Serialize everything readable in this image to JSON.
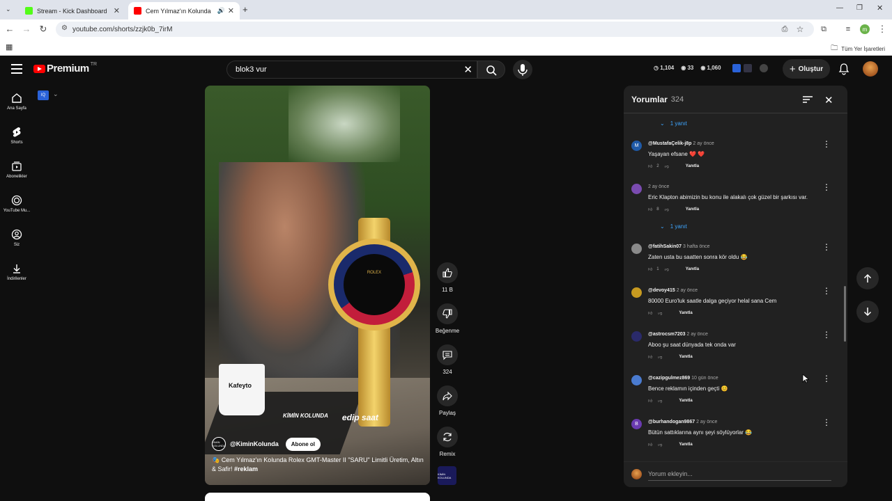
{
  "browser": {
    "tabs": [
      {
        "title": "Stream - Kick Dashboard",
        "favicon_color": "#53fc18"
      },
      {
        "title": "Cem Yılmaz'ın Kolunda",
        "favicon_color": "#ff0000"
      }
    ],
    "url": "youtube.com/shorts/zzjk0b_7irM",
    "bookmarks_label": "Tüm Yer İşaretleri",
    "profile_initial": "m"
  },
  "header": {
    "brand": "Premium",
    "region": "TR",
    "search_value": "blok3 vur",
    "stats": {
      "clock": "1,104",
      "eye_a": "33",
      "eye_b": "1,060"
    },
    "create_label": "Oluştur"
  },
  "sidebar": {
    "items": [
      {
        "label": "Ana Sayfa",
        "icon": "home-icon"
      },
      {
        "label": "Shorts",
        "icon": "shorts-icon"
      },
      {
        "label": "Abonelikler",
        "icon": "subscriptions-icon"
      },
      {
        "label": "YouTube Mu...",
        "icon": "youtube-music-icon"
      },
      {
        "label": "Siz",
        "icon": "you-icon"
      },
      {
        "label": "İndirilenler",
        "icon": "downloads-icon"
      }
    ]
  },
  "video": {
    "cup_text": "Kafeyto",
    "brand_a": "KİMİN KOLUNDA",
    "brand_b": "edip saat",
    "watch_brand": "ROLEX",
    "channel_name": "@KiminKolunda",
    "channel_avatar_text": "KİMİN KOLUNDA",
    "subscribe_label": "Abone ol",
    "caption_emoji": "🎭",
    "caption": "Cem Yılmaz'ın Kolunda Rolex GMT-Master II \"SARU\" Limitli Üretim, Altın & Safir!",
    "caption_tag": "#reklam"
  },
  "actions": {
    "like_count": "11 B",
    "dislike_label": "Beğenme",
    "comments_count": "324",
    "share_label": "Paylaş",
    "remix_label": "Remix"
  },
  "comments": {
    "title": "Yorumlar",
    "count": "324",
    "reply_label": "Yanıtla",
    "replies_toggle": "1 yanıt",
    "add_placeholder": "Yorum ekleyin...",
    "items": [
      {
        "user": "@MustafaÇelik-j8p",
        "time": "2 ay önce",
        "text": "Yaşayan efsane ❤️ ❤️",
        "likes": "2",
        "avatar": "M",
        "avatar_color": "#1f5aa8"
      },
      {
        "user": "",
        "time": "2 ay önce",
        "text": "Eric Klapton abimizin bu konu ile alakalı çok güzel bir şarkısı var.",
        "likes": "8",
        "avatar": "",
        "avatar_color": "#7a4bb0"
      },
      {
        "user": "@fatihSakin07",
        "time": "3 hafta önce",
        "text": "Zaten usta bu saatten sonra kör oldu 😂",
        "likes": "1",
        "avatar": "",
        "avatar_color": "#8a8a8a"
      },
      {
        "user": "@devoy415",
        "time": "2 ay önce",
        "text": "80000 Euro'luk saatle dalga geçiyor helal sana Cem",
        "likes": "",
        "avatar": "",
        "avatar_color": "#c79a20"
      },
      {
        "user": "@astrocsm7203",
        "time": "2 ay önce",
        "text": "Aboo şu saat dünyada tek onda var",
        "likes": "",
        "avatar": "",
        "avatar_color": "#2a2a6a"
      },
      {
        "user": "@cazipgulmez869",
        "time": "10 gün önce",
        "text": "Bence reklamın içinden geçti 😊",
        "likes": "",
        "avatar": "",
        "avatar_color": "#4a7bd0"
      },
      {
        "user": "@burhandogan9867",
        "time": "2 ay önce",
        "text": "Bütün sattıklarına aynı şeyi söylüyorlar 😂",
        "likes": "",
        "avatar": "B",
        "avatar_color": "#6a3ab0"
      }
    ]
  }
}
